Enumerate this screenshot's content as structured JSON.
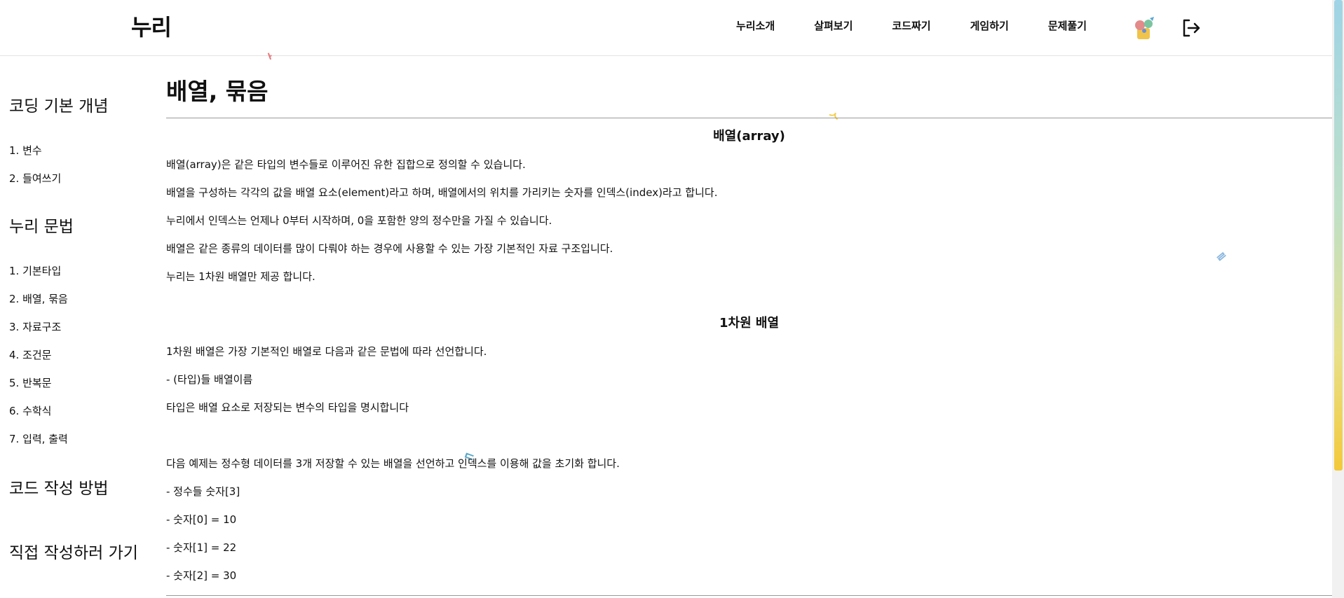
{
  "header": {
    "logo": "누리",
    "nav": [
      "누리소개",
      "살펴보기",
      "코드짜기",
      "게임하기",
      "문제풀기"
    ]
  },
  "sidebar": {
    "section1": "코딩 기본 개념",
    "basics": [
      "1. 변수",
      "2. 들여쓰기"
    ],
    "section2": "누리 문법",
    "grammar": [
      "1. 기본타입",
      "2. 배열, 묶음",
      "3. 자료구조",
      "4. 조건문",
      "5. 반복문",
      "6. 수학식",
      "7. 입력, 출력"
    ],
    "section3": "코드 작성 방법",
    "section4": "직접 작성하러 가기"
  },
  "main": {
    "title": "배열, 묶음",
    "s1_heading": "배열(array)",
    "s1_paras": [
      "배열(array)은 같은 타입의 변수들로 이루어진 유한 집합으로 정의할 수 있습니다.",
      "배열을 구성하는 각각의 값을 배열 요소(element)라고 하며, 배열에서의 위치를 가리키는 숫자를 인덱스(index)라고 합니다.",
      "누리에서 인덱스는 언제나 0부터 시작하며, 0을 포함한 양의 정수만을 가질 수 있습니다.",
      "배열은 같은 종류의 데이터를 많이 다뤄야 하는 경우에 사용할 수 있는 가장 기본적인 자료 구조입니다.",
      "누리는 1차원 배열만 제공 합니다."
    ],
    "s2_heading": "1차원 배열",
    "s2_paras": [
      "1차원 배열은 가장 기본적인 배열로 다음과 같은 문법에 따라 선언합니다.",
      "- (타입)들 배열이름",
      "타입은 배열 요소로 저장되는 변수의 타입을 명시합니다"
    ],
    "s3_paras": [
      "다음 예제는 정수형 데이터를 3개 저장할 수 있는 배열을 선언하고 인덱스를 이용해 값을 초기화 합니다.",
      "- 정수들 숫자[3]",
      "- 숫자[0] = 10",
      "- 숫자[1] = 22",
      "- 숫자[2] = 30"
    ]
  },
  "colors": {
    "scroll_top": "#9fd4e6",
    "scroll_bottom": "#f3c93a"
  }
}
